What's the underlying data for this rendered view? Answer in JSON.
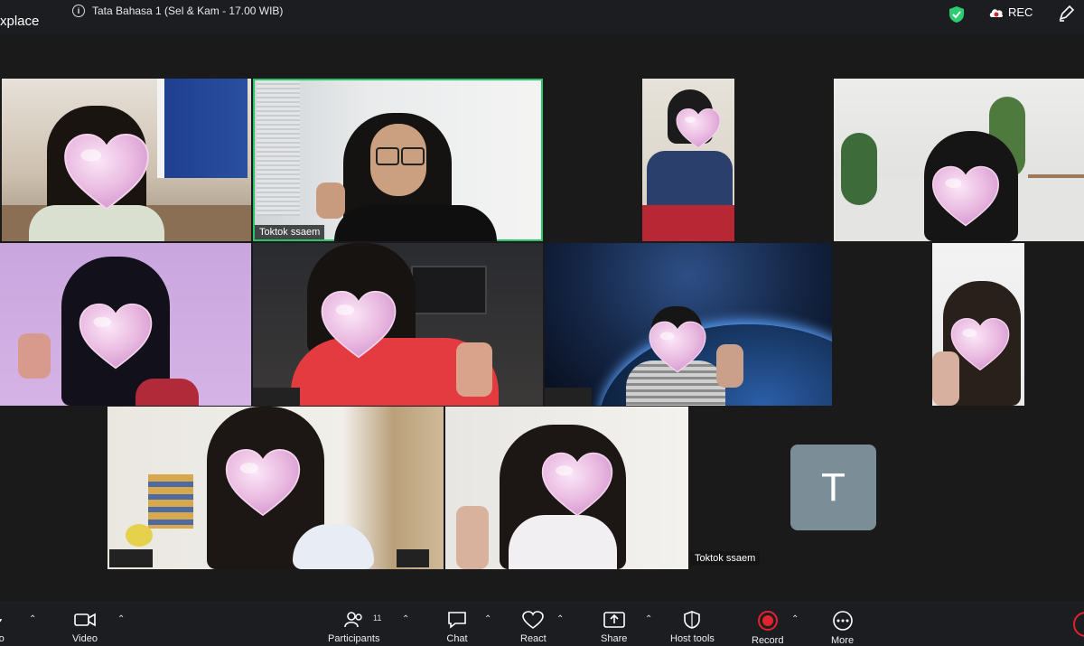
{
  "topbar": {
    "app_name": "xplace",
    "meeting_title": "Tata Bahasa 1 (Sel & Kam - 17.00 WIB)",
    "rec_label": "REC"
  },
  "stage": {
    "active_speaker_name": "Toktok ssaem",
    "avatar_tile_name": "Toktok ssaem",
    "avatar_initial": "T"
  },
  "controls": {
    "audio_label": "udio",
    "video_label": "Video",
    "participants_label": "Participants",
    "participants_count": "11",
    "chat_label": "Chat",
    "react_label": "React",
    "share_label": "Share",
    "host_tools_label": "Host tools",
    "record_label": "Record",
    "more_label": "More"
  },
  "colors": {
    "active_border": "#27c46a",
    "record": "#e0242f",
    "avatar_bg": "#7b8d96",
    "shield": "#2ecc71"
  }
}
